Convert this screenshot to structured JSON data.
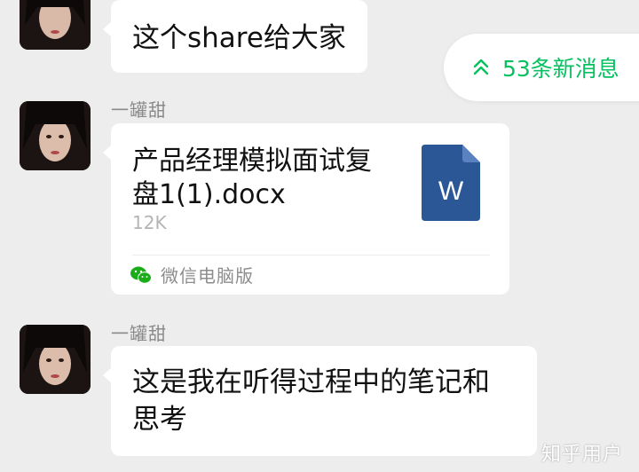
{
  "new_messages_pill": {
    "label": "53条新消息",
    "icon": "double-chevron-up-icon",
    "color": "#07c160"
  },
  "messages": [
    {
      "type": "text",
      "sender": "",
      "text": "这个share给大家"
    },
    {
      "type": "file",
      "sender": "一罐甜",
      "file": {
        "name": "产品经理模拟面试复盘1(1).docx",
        "size": "12K",
        "icon": "word-document-icon",
        "icon_letter": "W",
        "icon_color": "#2b5797",
        "source": "微信电脑版",
        "source_icon": "wechat-icon"
      }
    },
    {
      "type": "text",
      "sender": "一罐甜",
      "text": "这是我在听得过程中的笔记和思考"
    }
  ],
  "watermark": "知乎用户"
}
